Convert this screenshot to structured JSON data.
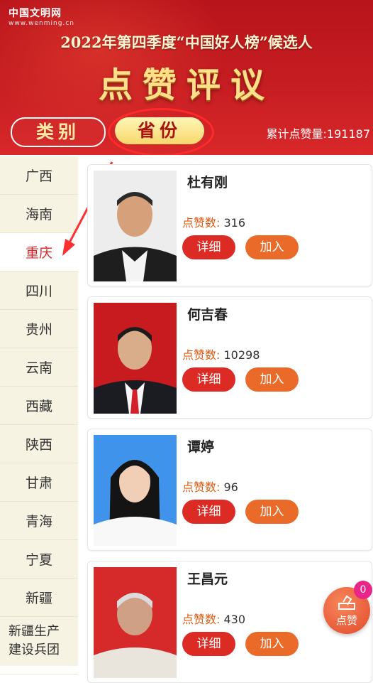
{
  "header": {
    "logo_cn": "中国文明网",
    "logo_en": "www.wenming.cn",
    "subtitle": "2022年第四季度“中国好人榜”候选人",
    "title": "点赞评议",
    "tab_category": "类别",
    "tab_province": "省份",
    "total_label": "累计点赞量:",
    "total_value": "191187"
  },
  "sidebar": {
    "items": [
      "广西",
      "海南",
      "重庆",
      "四川",
      "贵州",
      "云南",
      "西藏",
      "陕西",
      "甘肃",
      "青海",
      "宁夏",
      "新疆",
      "新疆生产建设兵团"
    ],
    "active": "重庆"
  },
  "labels": {
    "likes_label": "点赞数:",
    "detail": "详细",
    "join": "加入"
  },
  "candidates": [
    {
      "name": "杜有刚",
      "likes": "316"
    },
    {
      "name": "何吉春",
      "likes": "10298"
    },
    {
      "name": "谭婷",
      "likes": "96"
    },
    {
      "name": "王昌元",
      "likes": "430"
    }
  ],
  "vote_fab": {
    "label": "点赞",
    "count": "0"
  },
  "colors": {
    "primary_red": "#dc2b24",
    "orange": "#ea6a2a",
    "sidebar_bg": "#f7f3e3",
    "header_red": "#c61d22"
  }
}
